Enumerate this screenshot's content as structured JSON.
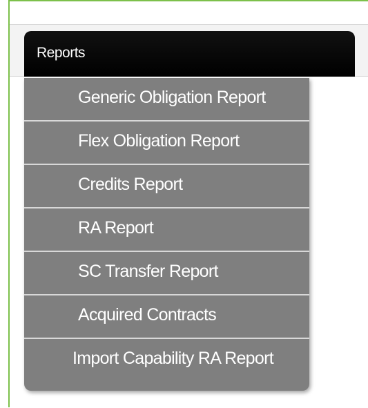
{
  "menu": {
    "title": "Reports",
    "items": [
      {
        "label": "Generic Obligation Report"
      },
      {
        "label": "Flex Obligation Report"
      },
      {
        "label": "Credits Report"
      },
      {
        "label": "RA Report"
      },
      {
        "label": "SC Transfer Report"
      },
      {
        "label": "Acquired Contracts"
      },
      {
        "label": "Import Capability RA Report"
      }
    ]
  }
}
